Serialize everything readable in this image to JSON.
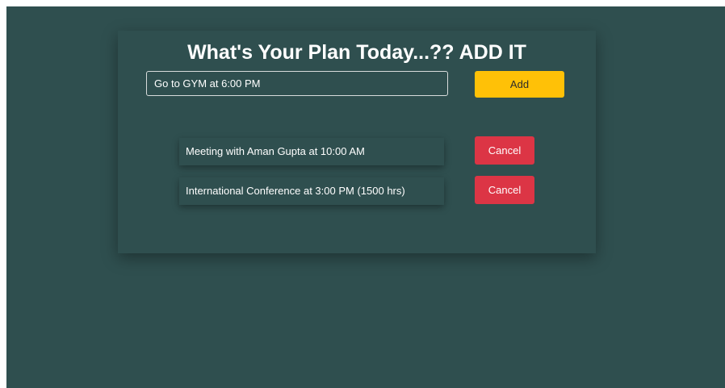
{
  "header": {
    "title": "What's Your Plan Today...?? ADD IT"
  },
  "input": {
    "value": "Go to GYM at 6:00 PM",
    "placeholder": ""
  },
  "add_button": {
    "label": "Add"
  },
  "tasks": [
    {
      "text": "Meeting with Aman Gupta at 10:00 AM",
      "cancel_label": "Cancel"
    },
    {
      "text": "International Conference at 3:00 PM (1500 hrs)",
      "cancel_label": "Cancel"
    }
  ],
  "colors": {
    "background": "#2f4f4f",
    "add_button": "#ffc107",
    "cancel_button": "#dc3545",
    "text": "#ffffff"
  }
}
